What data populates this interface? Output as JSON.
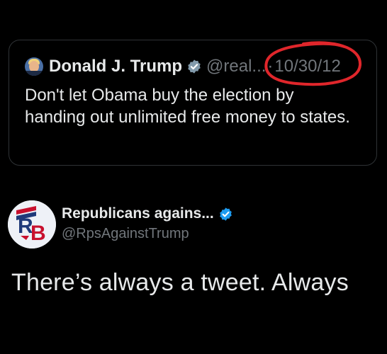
{
  "quoted_tweet": {
    "author_name": "Donald J. Trump",
    "handle": "@real...",
    "separator": "·",
    "date": "10/30/12",
    "text": "Don't let Obama buy the election by handing out unlimited free money to states."
  },
  "tweet": {
    "author_name": "Republicans agains...",
    "handle": "@RpsAgainstTrump",
    "avatar_letters": "RB",
    "text": "There’s always a tweet. Always"
  },
  "colors": {
    "background": "#000000",
    "primary_text": "#e7e9ea",
    "secondary_text": "#71767b",
    "verified_gray": "#829aab",
    "verified_blue": "#1d9bf0",
    "annotation_red": "#e0262b"
  }
}
